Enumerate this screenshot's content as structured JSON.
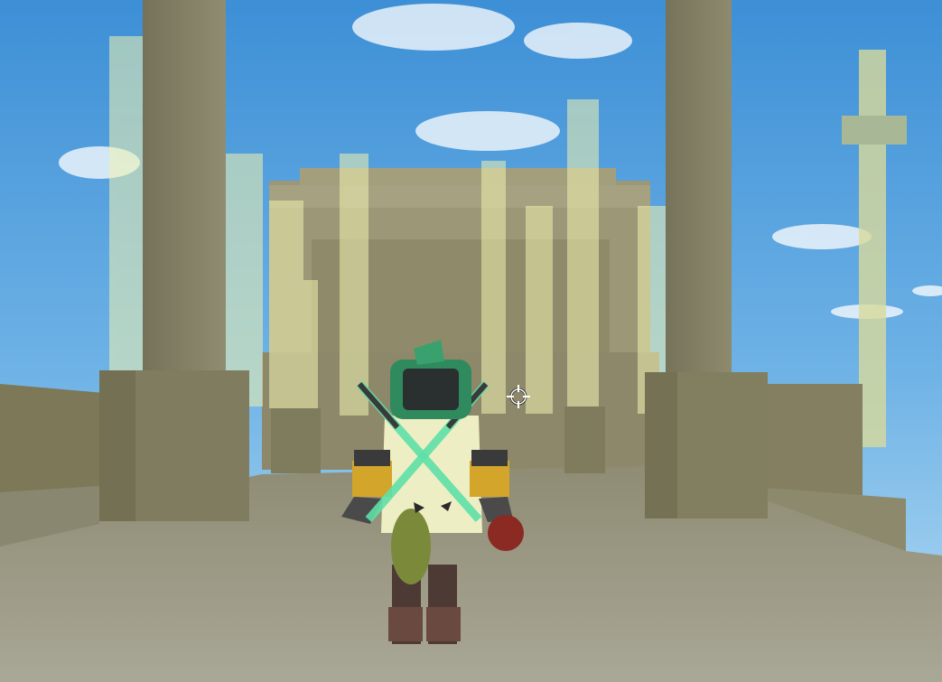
{
  "scene": {
    "type": "3d-game-viewport",
    "view": "third-person",
    "environment": "sky-temple-ruins",
    "colors": {
      "sky_top": "#3d8fd6",
      "sky_bottom": "#a9d3f0",
      "stone": "#8a8668",
      "stone_dark": "#6e6b50",
      "floor": "#9c9a88",
      "glass_pillar": "#e8ebaa",
      "character_coat": "#eeeec4",
      "character_helmet": "#2f8a5e",
      "crossed_swords": "#5fe0a8"
    }
  },
  "hud": {
    "crosshair_icon": "crosshair-icon"
  }
}
